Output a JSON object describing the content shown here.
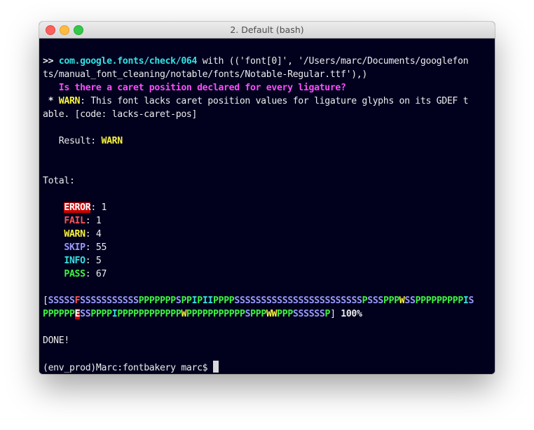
{
  "window": {
    "title": "2. Default (bash)"
  },
  "terminal": {
    "cmd_prompt": ">> ",
    "cmd_check": "com.google.fonts/check/064",
    "cmd_args_1": " with (('font[0]', '/Users/marc/Documents/googlefon",
    "cmd_args_2": "ts/manual_font_cleaning/notable/fonts/Notable-Regular.ttf'),)",
    "question": "   Is there a caret position declared for every ligature?",
    "warn_prefix": " * ",
    "warn_label": "WARN",
    "warn_msg_1": ": This font lacks caret position values for ligature glyphs on its GDEF t",
    "warn_msg_2": "able. [code: lacks-caret-pos]",
    "result_label": "   Result: ",
    "result_value": "WARN",
    "total_label": "Total:",
    "totals": {
      "error_label": "ERROR",
      "error_count": ": 1",
      "fail_label": "FAIL",
      "fail_count": ": 1",
      "warn_label": "WARN",
      "warn_count": ": 4",
      "skip_label": "SKIP",
      "skip_count": ": 55",
      "info_label": "INFO",
      "info_count": ": 5",
      "pass_label": "PASS",
      "pass_count": ": 67"
    },
    "progress": {
      "open": "[",
      "line1": "SSSSSFSSSSSSSSSSSPPPPPPPSPPIPIIPPPPSSSSSSSSSSSSSSSSSSSSSSSSPSSSPPPWSSPPPPPPPPPIS",
      "line2": "PPPPPPESSPPPPIPPPPPPPPPPPPWPPPPPPPPPPPSPPPWWPPPSSSSSSP",
      "close": "]",
      "percent": " 100%"
    },
    "done": "DONE!",
    "prompt": "(env_prod)Marc:fontbakery marc$ "
  },
  "colors": {
    "S": "#9b9bff",
    "P": "#3cf73c",
    "I": "#34e2e2",
    "W": "#fbf53c",
    "F": "#ff5555",
    "E": "#cc0000"
  }
}
